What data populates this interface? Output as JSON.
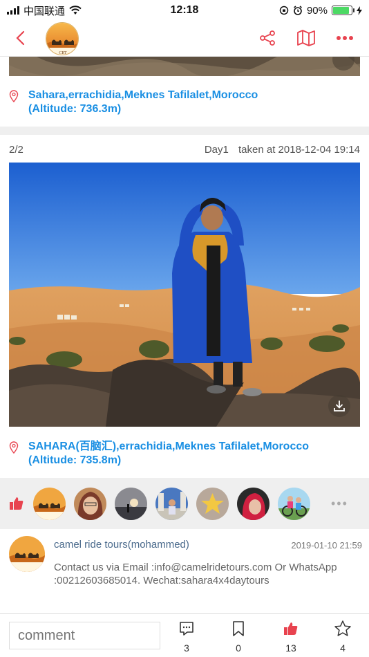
{
  "status_bar": {
    "carrier": "中国联通",
    "time": "12:18",
    "battery_percent": "90%",
    "battery_level": 0.9
  },
  "nav": {
    "logo_text": "Camel Ride Tours",
    "logo_initials": "CRT"
  },
  "photos": [
    {
      "location": "Sahara,errachidia,Meknes Tafilalet,Morocco",
      "altitude": "(Altitude: 736.3m)"
    },
    {
      "index": "2/2",
      "day": "Day1",
      "taken_at": "taken at 2018-12-04 19:14",
      "location": "SAHARA(百脑汇),errachidia,Meknes Tafilalet,Morocco",
      "altitude": "(Altitude: 735.8m)"
    }
  ],
  "likes": {
    "avatars": [
      "avatar-camel-logo",
      "avatar-woman-glasses",
      "avatar-sunset",
      "avatar-person-outdoors",
      "avatar-star",
      "avatar-red-hair",
      "avatar-cyclists"
    ],
    "more": "•••"
  },
  "comment": {
    "author": "camel ride tours(mohammed)",
    "date": "2019-01-10 21:59",
    "text": "Contact us via Email :info@camelridetours.com Or WhatsApp :00212603685014. Wechat:sahara4x4daytours"
  },
  "bottom_bar": {
    "comment_placeholder": "comment",
    "comments_count": "3",
    "bookmarks_count": "0",
    "likes_count": "13",
    "favorites_count": "4"
  },
  "colors": {
    "accent": "#e8434f",
    "link": "#1a8fe3"
  }
}
